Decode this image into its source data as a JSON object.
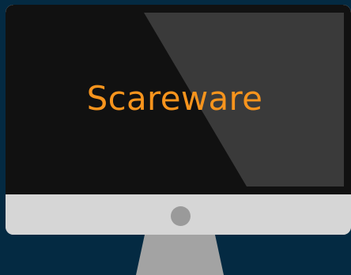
{
  "screen": {
    "title": "Scareware",
    "title_color": "#f7941d",
    "background_color": "#111111"
  },
  "monitor": {
    "frame_color": "#d6d6d6",
    "button_color": "#9a9a9a",
    "stand_color": "#a3a3a3"
  },
  "page": {
    "background_color": "#042a42"
  }
}
